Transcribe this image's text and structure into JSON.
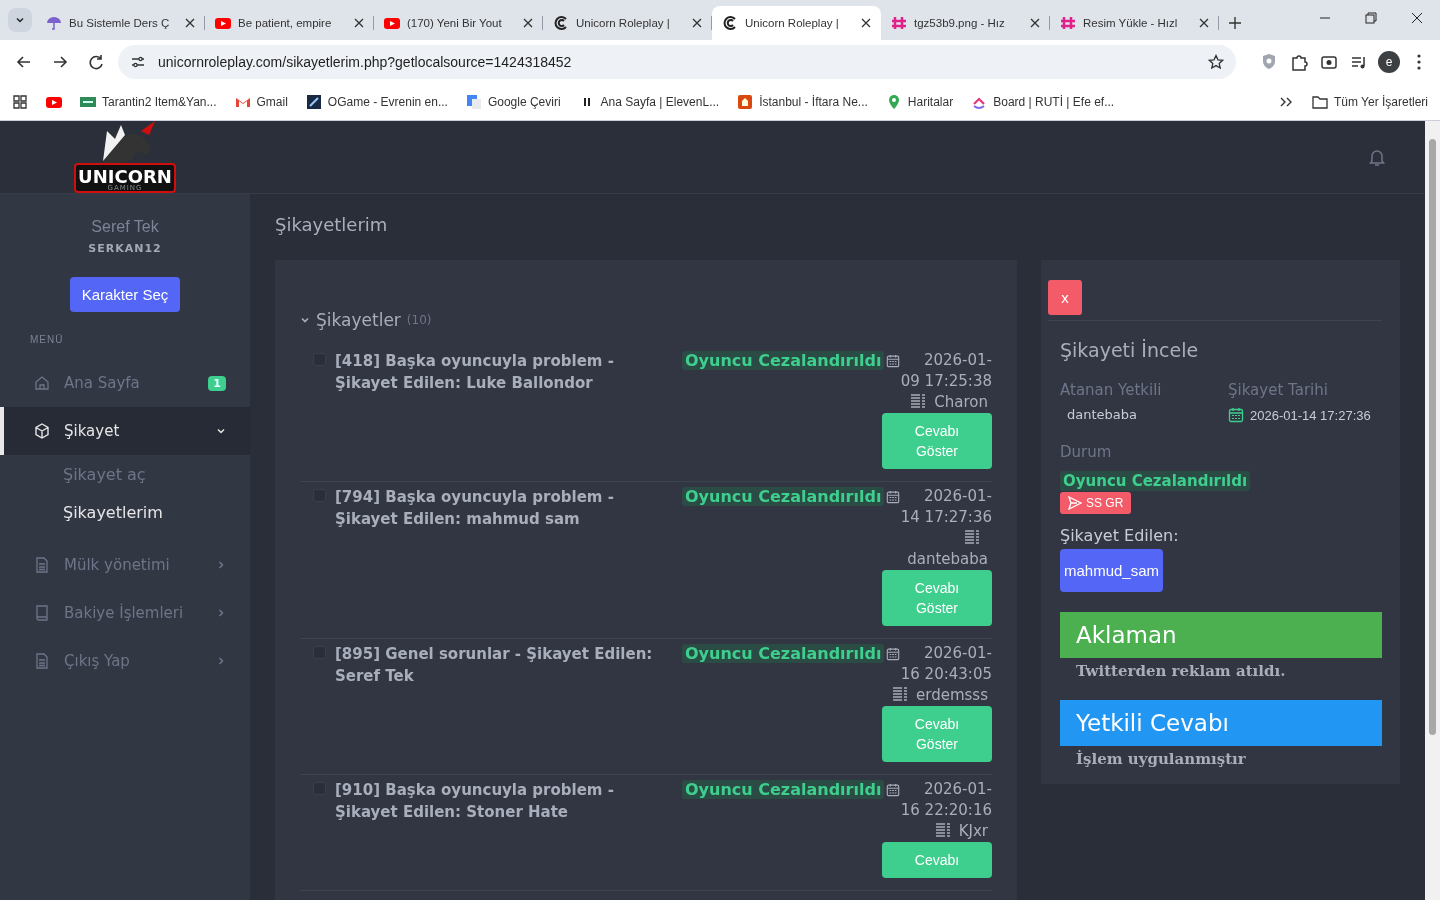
{
  "browser": {
    "tabs": [
      {
        "title": "Bu Sistemle Ders Ç",
        "kind": "umbrella",
        "selected": false
      },
      {
        "title": "Be patient, empire",
        "kind": "youtube",
        "selected": false
      },
      {
        "title": "(170) Yeni Bir Yout",
        "kind": "youtube",
        "selected": false
      },
      {
        "title": "Unicorn Roleplay |",
        "kind": "unicorn",
        "selected": false
      },
      {
        "title": "Unicorn Roleplay |",
        "kind": "unicorn",
        "selected": true
      },
      {
        "title": "tgz53b9.png - Hız",
        "kind": "hizli",
        "selected": false
      },
      {
        "title": "Resim Yükle - Hızl",
        "kind": "hizli",
        "selected": false
      }
    ],
    "url": "unicornroleplay.com/sikayetlerim.php?getlocalsource=1424318452",
    "profile": "e",
    "bookmarks": [
      {
        "kind": "youtube"
      },
      {
        "kind": "image",
        "label": "Tarantin2 Item&Yan..."
      },
      {
        "kind": "gmail",
        "label": "Gmail"
      },
      {
        "kind": "ogame",
        "label": "OGame - Evrenin en..."
      },
      {
        "kind": "translate",
        "label": "Google Çeviri"
      },
      {
        "kind": "pause",
        "label": "Ana Sayfa | ElevenL..."
      },
      {
        "kind": "istanbul",
        "label": "İstanbul - İftara Ne..."
      },
      {
        "kind": "maps",
        "label": "Haritalar"
      },
      {
        "kind": "board",
        "label": "Board | RUTİ | Efe ef..."
      }
    ],
    "all_bookmarks": "Tüm Yer İşaretleri"
  },
  "logo": {
    "text": "UNICORN",
    "subtitle": "GAMING"
  },
  "user": {
    "name": "Seref Tek",
    "username": "SERKAN12",
    "button": "Karakter Seç"
  },
  "menu": {
    "heading": "MENÜ",
    "items": [
      {
        "label": "Ana Sayfa",
        "kind": "home",
        "badge": "1",
        "selected": false
      },
      {
        "label": "Şikayet",
        "kind": "cube",
        "selected": true,
        "expanded": true,
        "children": [
          {
            "label": "Şikayet aç",
            "selected": false
          },
          {
            "label": "Şikayetlerim",
            "selected": true
          }
        ]
      },
      {
        "label": "Mülk yönetimi",
        "kind": "file",
        "selected": false,
        "expanded": false
      },
      {
        "label": "Bakiye İşlemleri",
        "kind": "book",
        "selected": false,
        "expanded": false
      },
      {
        "label": "Çıkış Yap",
        "kind": "file",
        "selected": false,
        "expanded": false
      }
    ]
  },
  "page_title": "Şikayetlerim",
  "complaints": {
    "heading": "Şikayetler",
    "count": "(10)",
    "expanded": true,
    "items": [
      {
        "title": "[418] Başka oyuncuyla problem - Şikayet Edilen: Luke Ballondor",
        "checked": false,
        "status": "Oyuncu Cezalandırıldı",
        "date": "2026-01-09 17:25:38",
        "author": "Charon",
        "button": "Cevabı Göster"
      },
      {
        "title": "[794] Başka oyuncuyla problem - Şikayet Edilen: mahmud sam",
        "checked": false,
        "status": "Oyuncu Cezalandırıldı",
        "date": "2026-01-14 17:27:36",
        "author": "dantebaba",
        "button": "Cevabı Göster"
      },
      {
        "title": "[895] Genel sorunlar - Şikayet Edilen: Seref Tek",
        "checked": false,
        "status": "Oyuncu Cezalandırıldı",
        "date": "2026-01-16 20:43:05",
        "author": "erdemsss",
        "button": "Cevabı Göster"
      },
      {
        "title": "[910] Başka oyuncuyla problem - Şikayet Edilen: Stoner Hate",
        "checked": false,
        "status": "Oyuncu Cezalandırıldı",
        "date": "2026-01-16 22:20:16",
        "author": "KJxr",
        "button": "Cevabı"
      }
    ]
  },
  "detail": {
    "close": "x",
    "title": "Şikayeti İncele",
    "assigned_label": "Atanan Yetkili",
    "assigned": "dantebaba",
    "date_label": "Şikayet Tarihi",
    "date": "2026-01-14 17:27:36",
    "status_label": "Durum",
    "status": "Oyuncu Cezalandırıldı",
    "evidence_button": "SS GR",
    "reported_label": "Şikayet Edilen:",
    "reported": "mahmud_sam",
    "sections": [
      {
        "heading": "Aklaman",
        "body": "Twitterden reklam atıldı.",
        "color": "#4caf50"
      },
      {
        "heading": "Yetkili Cevabı",
        "body": "İşlem uygulanmıştır",
        "color": "#2196f3"
      }
    ]
  }
}
